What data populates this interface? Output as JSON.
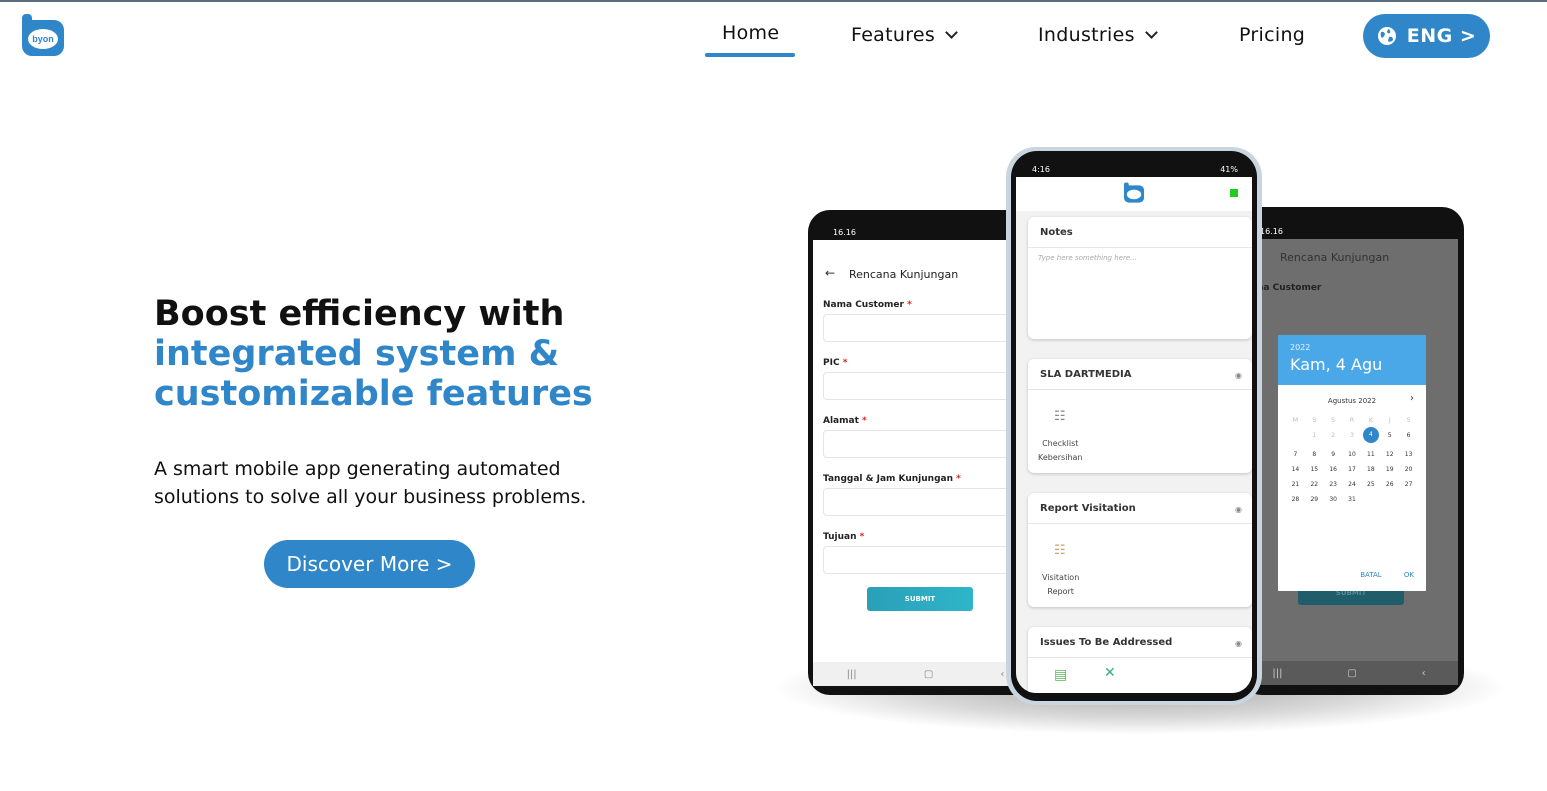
{
  "header": {
    "logo_text": "byon",
    "nav": {
      "home": "Home",
      "features": "Features",
      "industries": "Industries",
      "pricing": "Pricing"
    },
    "language_button": "ENG >"
  },
  "hero": {
    "title_line1": "Boost efficiency with",
    "title_line2": "integrated system &",
    "title_line3": "customizable features",
    "description": "A smart mobile app generating automated solutions to solve all your business problems.",
    "cta_label": "Discover More >"
  },
  "phone_left": {
    "status_time": "16.16",
    "title": "Rencana Kunjungan",
    "fields": [
      {
        "label": "Nama Customer"
      },
      {
        "label": "PIC"
      },
      {
        "label": "Alamat"
      },
      {
        "label": "Tanggal & Jam Kunjungan"
      },
      {
        "label": "Tujuan"
      }
    ],
    "required_mark": "*",
    "submit_label": "SUBMIT"
  },
  "phone_center": {
    "status_time": "4:16",
    "status_battery": "41%",
    "notes_title": "Notes",
    "notes_placeholder": "Type here something here...",
    "sla_title": "SLA DARTMEDIA",
    "sla_tile_line1": "Checklist",
    "sla_tile_line2": "Kebersihan",
    "report_title": "Report Visitation",
    "report_tile_line1": "Visitation",
    "report_tile_line2": "Report",
    "issues_title": "Issues To Be Addressed"
  },
  "phone_right": {
    "status_time": "16.16",
    "title": "Rencana Kunjungan",
    "field_partial": "ma Customer",
    "datepicker": {
      "year": "2022",
      "date": "Kam, 4 Agu",
      "month": "Agustus 2022",
      "weekdays": [
        "M",
        "S",
        "S",
        "R",
        "K",
        "J",
        "S"
      ],
      "days": [
        "",
        "1",
        "2",
        "3",
        "4",
        "5",
        "6",
        "7",
        "8",
        "9",
        "10",
        "11",
        "12",
        "13",
        "14",
        "15",
        "16",
        "17",
        "18",
        "19",
        "20",
        "21",
        "22",
        "23",
        "24",
        "25",
        "26",
        "27",
        "28",
        "29",
        "30",
        "31"
      ],
      "selected_day": "4",
      "cancel": "BATAL",
      "ok": "OK"
    },
    "submit_label": "SUBMIT"
  },
  "colors": {
    "brand_blue": "#2f86c8",
    "datepicker_blue": "#4aa8e8",
    "submit_teal": "#2fb5c9"
  },
  "icons": {
    "logo": "byon-logo-icon",
    "language": "globe-icon",
    "dropdown": "chevron-down-icon"
  }
}
